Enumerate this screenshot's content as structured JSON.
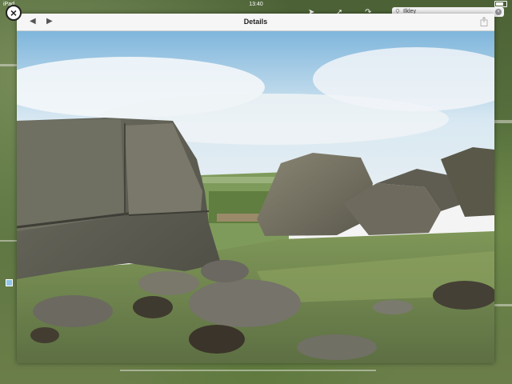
{
  "status_bar": {
    "device": "iPad",
    "time": "13:40"
  },
  "search": {
    "value": "Ilkley"
  },
  "modal": {
    "title": "Details"
  },
  "colors": {
    "sky_top": "#7fb6dc",
    "grass": "#6f8f4a",
    "rock": "#6b6a5c",
    "header_bg": "#f6f6f6"
  },
  "icons": {
    "close": "close-icon",
    "back": "left-arrow-icon",
    "forward": "right-arrow-icon",
    "share": "share-icon",
    "search": "search-icon",
    "clear": "clear-icon"
  }
}
